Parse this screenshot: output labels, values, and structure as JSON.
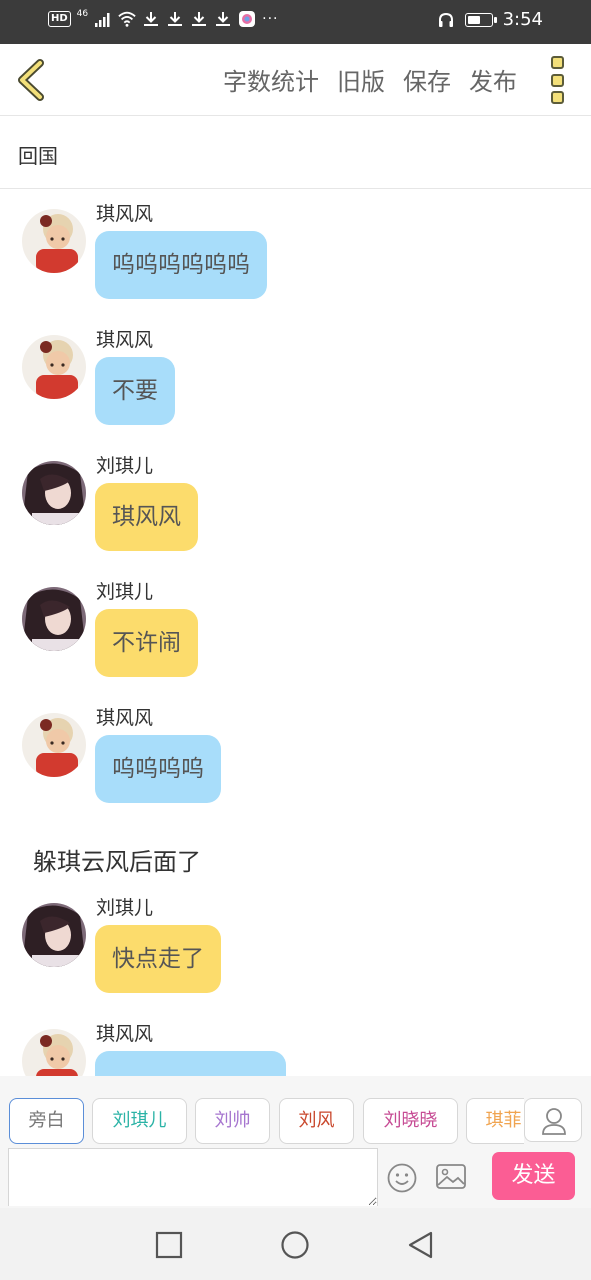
{
  "status_bar": {
    "network_badge": "HD",
    "network_type": "46",
    "more": "···",
    "time": "3:54",
    "battery_level": 0.55,
    "icons": [
      "hd-icon",
      "signal-icon",
      "wifi-icon",
      "download-icon",
      "download-icon",
      "download-icon",
      "download-icon",
      "app-icon",
      "headphone-icon",
      "battery-icon"
    ]
  },
  "toolbar": {
    "back_icon": "chevron-left-icon",
    "word_count": "字数统计",
    "old_version": "旧版",
    "save": "保存",
    "publish": "发布",
    "more_icon": "more-vertical-icon"
  },
  "chapter": {
    "title": "回国"
  },
  "messages": [
    {
      "type": "dialogue",
      "sender": "琪风风",
      "text": "呜呜呜呜呜呜",
      "color": "blue"
    },
    {
      "type": "dialogue",
      "sender": "琪风风",
      "text": "不要",
      "color": "blue"
    },
    {
      "type": "dialogue",
      "sender": "刘琪儿",
      "text": "琪风风",
      "color": "yellow"
    },
    {
      "type": "dialogue",
      "sender": "刘琪儿",
      "text": "不许闹",
      "color": "yellow"
    },
    {
      "type": "dialogue",
      "sender": "琪风风",
      "text": "呜呜呜呜",
      "color": "blue"
    },
    {
      "type": "narration",
      "text": "躲琪云风后面了"
    },
    {
      "type": "dialogue",
      "sender": "刘琪儿",
      "text": "快点走了",
      "color": "yellow"
    },
    {
      "type": "dialogue",
      "sender": "琪风风",
      "text": "",
      "color": "blue"
    }
  ],
  "characters": [
    {
      "label": "旁白",
      "color": "#777777",
      "active": true
    },
    {
      "label": "刘琪儿",
      "color": "#2bb3a6"
    },
    {
      "label": "刘帅",
      "color": "#a675cf"
    },
    {
      "label": "刘风",
      "color": "#c9472c"
    },
    {
      "label": "刘晓晓",
      "color": "#c64a93"
    },
    {
      "label": "琪菲",
      "color": "#f0a450"
    }
  ],
  "input": {
    "placeholder": "",
    "send_label": "发送"
  },
  "colors": {
    "bubble_blue": "#a8ddfa",
    "bubble_yellow": "#fcdc6c",
    "send_button": "#fb5d94",
    "status_bar": "#3b3b3b"
  }
}
